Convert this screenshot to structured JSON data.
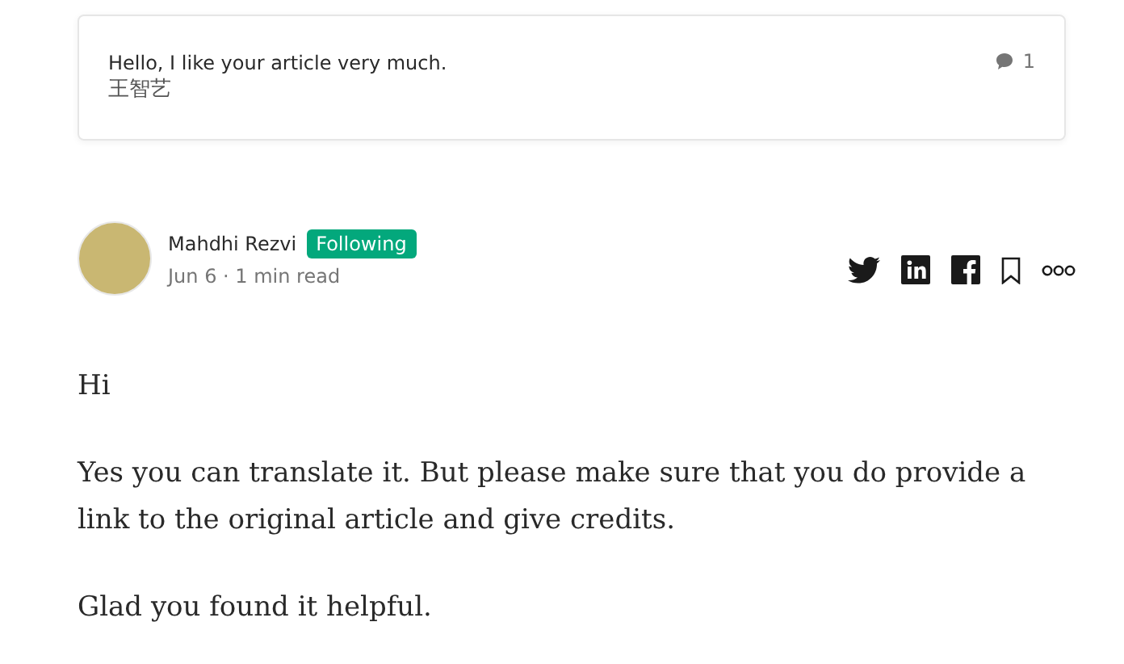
{
  "response_card": {
    "text": "Hello, I like your article very much.",
    "author": "王智艺",
    "response_count": "1"
  },
  "author": {
    "name": "Mahdhi Rezvi",
    "follow_badge": "Following",
    "meta": "Jun 6 · 1 min read"
  },
  "body": [
    "Hi",
    "Yes you can translate it. But please make sure that you do provide a link to the original article and give credits.",
    "Glad you found it helpful."
  ]
}
